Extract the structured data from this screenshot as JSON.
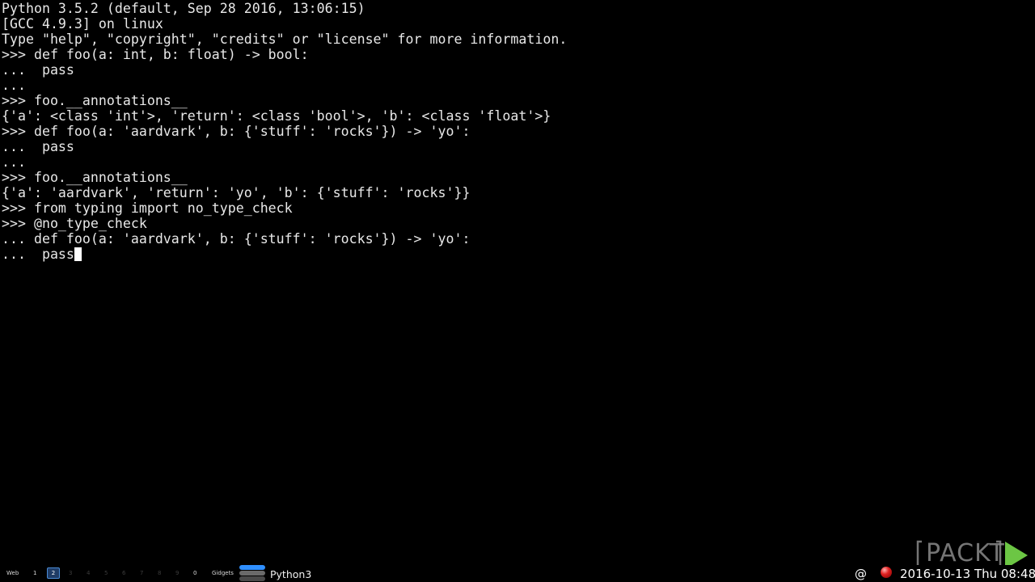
{
  "terminal": {
    "lines": [
      "Python 3.5.2 (default, Sep 28 2016, 13:06:15)",
      "[GCC 4.9.3] on linux",
      "Type \"help\", \"copyright\", \"credits\" or \"license\" for more information.",
      ">>> def foo(a: int, b: float) -> bool:",
      "...  pass",
      "...",
      ">>> foo.__annotations__",
      "{'a': <class 'int'>, 'return': <class 'bool'>, 'b': <class 'float'>}",
      ">>> def foo(a: 'aardvark', b: {'stuff': 'rocks'}) -> 'yo':",
      "...  pass",
      "...",
      ">>> foo.__annotations__",
      "{'a': 'aardvark', 'return': 'yo', 'b': {'stuff': 'rocks'}}",
      ">>> from typing import no_type_check",
      ">>> @no_type_check",
      "... def foo(a: 'aardvark', b: {'stuff': 'rocks'}) -> 'yo':",
      "...  pass"
    ]
  },
  "panel": {
    "workspaces": {
      "web": "Web",
      "n1": "1",
      "n2": "2",
      "n3": "3",
      "n4": "4",
      "n5": "5",
      "n6": "6",
      "n7": "7",
      "n8": "8",
      "n9": "9",
      "n0": "0",
      "gidgets": "Gidgets"
    },
    "active_workspace": "2",
    "task_title": "Python3",
    "tray_symbol": "@",
    "clock": "2016-10-13 Thu 08:48"
  },
  "watermark": {
    "logo_text": "PACKT"
  },
  "colors": {
    "background": "#000000",
    "text": "#e8e8e8",
    "active_workspace": "#4a8bd6",
    "watermark_arrow": "#6cc644",
    "watermark_text": "#8a8a8a"
  }
}
